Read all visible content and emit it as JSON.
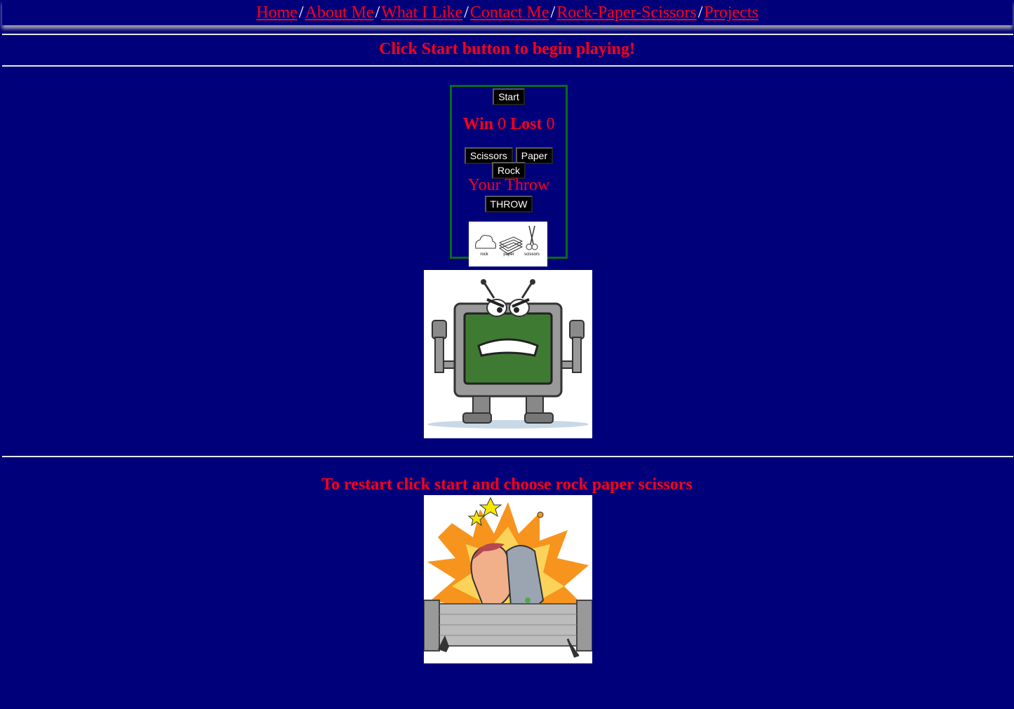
{
  "nav": {
    "items": [
      "Home",
      "About Me",
      "What I Like",
      "Contact Me",
      "Rock-Paper-Scissors",
      "Projects"
    ],
    "separator": "/"
  },
  "heading": "Click Start button to begin playing!",
  "game": {
    "start_label": "Start",
    "win_label": "Win",
    "win_count": "0",
    "lost_label": "Lost",
    "lost_count": "0",
    "scissors_label": "Scissors",
    "paper_label": "Paper",
    "rock_label": "Rock",
    "your_throw_label": "Your Throw",
    "throw_label": "THROW",
    "rps_captions": [
      "rock",
      "paper",
      "scissors"
    ]
  },
  "restart_text": "To restart click start and choose rock paper scissors",
  "colors": {
    "background": "#00007a",
    "text_red": "#ff0018",
    "box_border": "#0a6b18"
  }
}
